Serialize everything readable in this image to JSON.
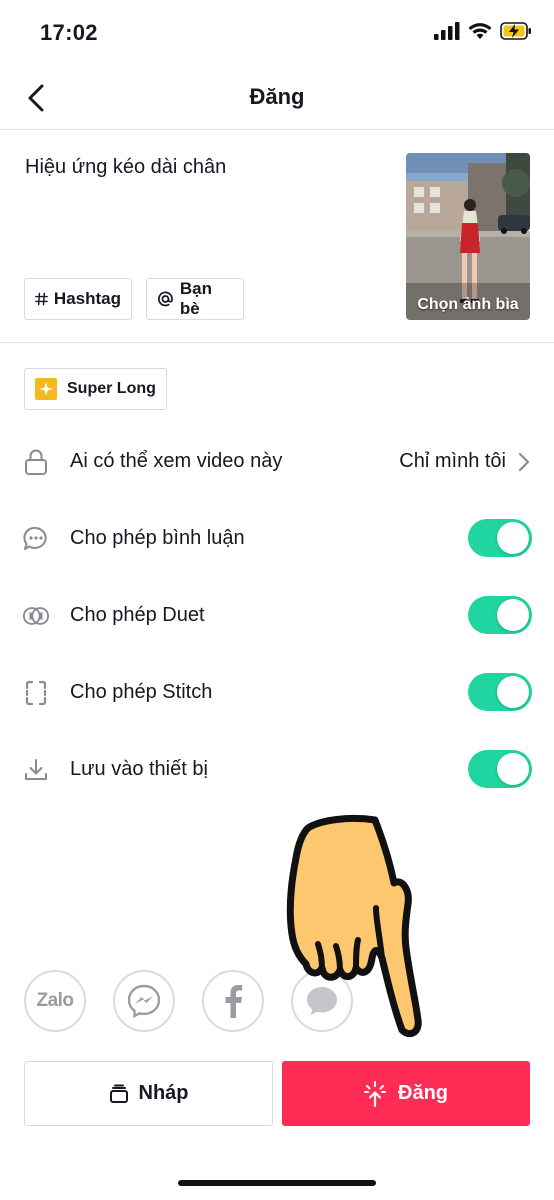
{
  "status_bar": {
    "time": "17:02"
  },
  "nav": {
    "title": "Đăng"
  },
  "post": {
    "caption": "Hiệu ứng kéo dài chân",
    "chips": {
      "hashtag": "Hashtag",
      "friends": "Bạn bè"
    },
    "cover_label": "Chọn ảnh bìa"
  },
  "effect": {
    "label": "Super Long",
    "icon": "effect-sparkle-icon"
  },
  "settings": {
    "privacy": {
      "label": "Ai có thể xem video này",
      "value": "Chỉ mình tôi",
      "icon": "lock-icon"
    },
    "comments": {
      "label": "Cho phép bình luận",
      "icon": "comment-icon",
      "enabled": true
    },
    "duet": {
      "label": "Cho phép Duet",
      "icon": "duet-icon",
      "enabled": true
    },
    "stitch": {
      "label": "Cho phép Stitch",
      "icon": "stitch-icon",
      "enabled": true
    },
    "save": {
      "label": "Lưu vào thiết bị",
      "icon": "download-icon",
      "enabled": true
    }
  },
  "share": {
    "zalo_label": "Zalo",
    "targets": [
      "zalo-icon",
      "messenger-icon",
      "facebook-icon",
      "message-icon"
    ]
  },
  "actions": {
    "draft_label": "Nháp",
    "post_label": "Đăng"
  },
  "colors": {
    "accent": "#fe2c55",
    "toggle_on": "#20d5a0",
    "text": "#161823",
    "border": "#d9d9db"
  }
}
